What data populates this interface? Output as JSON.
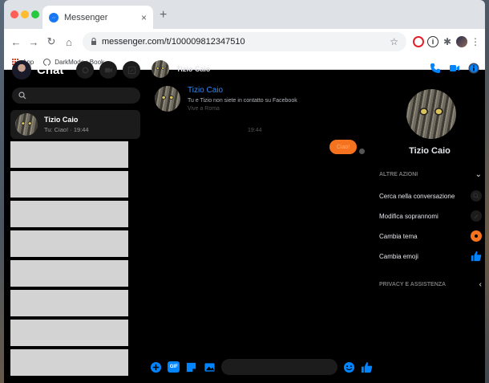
{
  "browser": {
    "tab_title": "Messenger",
    "tab_close": "×",
    "new_tab": "+",
    "url": "messenger.com/t/100009812347510",
    "bookmarks": [
      {
        "label": "App"
      },
      {
        "label": "DarkMode : Book..."
      }
    ],
    "colors": {
      "tabbar": "#dee1e6",
      "favicon": "#1877f2"
    }
  },
  "messenger": {
    "sidebar": {
      "title": "Chat",
      "search_placeholder": "",
      "conversations": [
        {
          "name": "Tizio Caio",
          "preview": "Tu: Ciao! · 19:44"
        }
      ]
    },
    "conversation": {
      "contact_name": "Tizio Caio",
      "intro_name": "Tizio Caio",
      "intro_subtitle": "Tu e Tizio non siete in contatto su Facebook",
      "intro_location": "Vive a Roma",
      "timestamp": "19:44",
      "sent_message": "Ciao!",
      "input_placeholder": "",
      "gif_label": "GIF"
    },
    "info_panel": {
      "name": "Tizio Caio",
      "sections": {
        "more_actions": "ALTRE AZIONI",
        "privacy": "PRIVACY E ASSISTENZA"
      },
      "actions": [
        {
          "label": "Cerca nella conversazione",
          "icon": "search-icon"
        },
        {
          "label": "Modifica soprannomi",
          "icon": "edit-icon"
        },
        {
          "label": "Cambia tema",
          "icon": "theme-color-icon"
        },
        {
          "label": "Cambia emoji",
          "icon": "thumbs-up-icon"
        }
      ]
    },
    "colors": {
      "accent": "#0084ff",
      "theme": "#f5731e",
      "background": "#000000"
    }
  }
}
